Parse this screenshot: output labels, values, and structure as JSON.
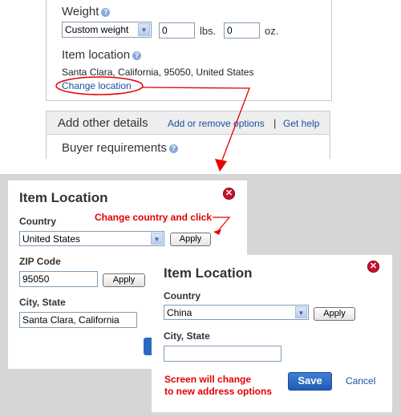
{
  "top_form": {
    "weight_label": "Weight",
    "weight_select": "Custom weight",
    "lbs_value": "0",
    "lbs_unit": "lbs.",
    "oz_value": "0",
    "oz_unit": "oz.",
    "item_location_label": "Item location",
    "location_value": "Santa Clara, California, 95050, United States",
    "change_location_link": "Change location",
    "details_title": "Add other details",
    "add_remove_link": "Add or remove options",
    "separator": "|",
    "get_help_link": "Get help",
    "buyer_requirements_label": "Buyer requirements"
  },
  "dialog1": {
    "title": "Item Location",
    "country_label": "Country",
    "country_value": "United States",
    "apply_label": "Apply",
    "zip_label": "ZIP Code",
    "zip_value": "95050",
    "zip_apply_label": "Apply",
    "city_label": "City, State",
    "city_value": "Santa Clara, California"
  },
  "dialog2": {
    "title": "Item Location",
    "country_label": "Country",
    "country_value": "China",
    "apply_label": "Apply",
    "city_label": "City, State",
    "city_value": "",
    "save_label": "Save",
    "cancel_label": "Cancel"
  },
  "annotations": {
    "change_country": "Change country and click",
    "screen_change_line1": "Screen will change",
    "screen_change_line2": "to new address options"
  },
  "colors": {
    "annotation_red": "#e30000",
    "link_blue": "#1a4fa0",
    "save_blue": "#2a69c4",
    "close_red": "#c8102e"
  }
}
